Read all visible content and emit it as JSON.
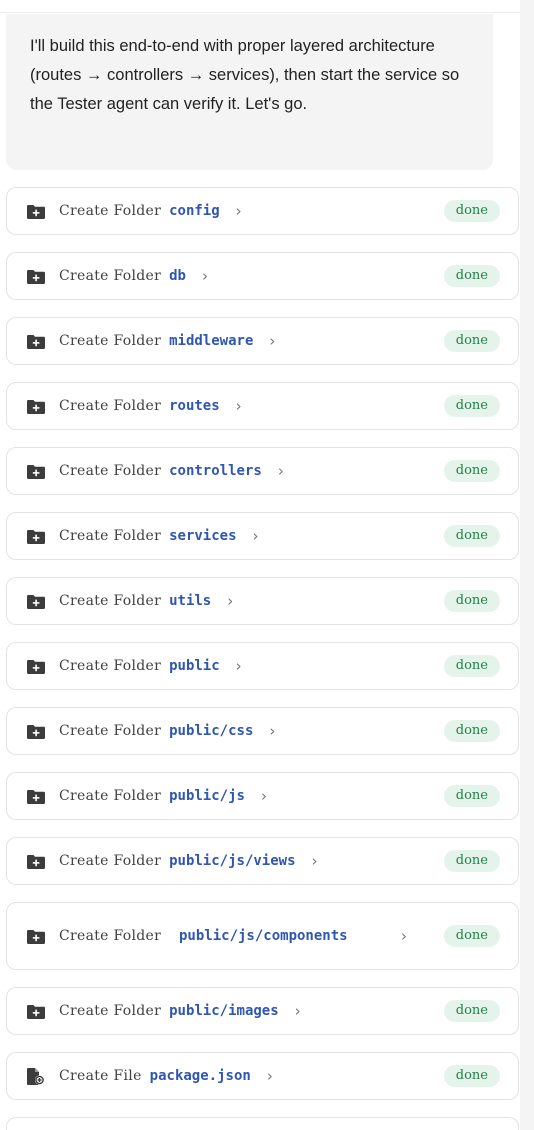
{
  "message": {
    "text": "I'll build this end-to-end with proper layered architecture (routes → controllers → services), then start the service so the Tester agent can verify it. Let's go."
  },
  "colors": {
    "target_text": "#2f56b3",
    "badge_bg": "#e4f4ea",
    "badge_text": "#24804a",
    "icon": "#3c3c3c"
  },
  "steps": [
    {
      "verb": "Create Folder",
      "target": "config",
      "status": "done",
      "icon": "folder-plus-icon"
    },
    {
      "verb": "Create Folder",
      "target": "db",
      "status": "done",
      "icon": "folder-plus-icon"
    },
    {
      "verb": "Create Folder",
      "target": "middleware",
      "status": "done",
      "icon": "folder-plus-icon"
    },
    {
      "verb": "Create Folder",
      "target": "routes",
      "status": "done",
      "icon": "folder-plus-icon"
    },
    {
      "verb": "Create Folder",
      "target": "controllers",
      "status": "done",
      "icon": "folder-plus-icon"
    },
    {
      "verb": "Create Folder",
      "target": "services",
      "status": "done",
      "icon": "folder-plus-icon"
    },
    {
      "verb": "Create Folder",
      "target": "utils",
      "status": "done",
      "icon": "folder-plus-icon"
    },
    {
      "verb": "Create Folder",
      "target": "public",
      "status": "done",
      "icon": "folder-plus-icon"
    },
    {
      "verb": "Create Folder",
      "target": "public/css",
      "status": "done",
      "icon": "folder-plus-icon"
    },
    {
      "verb": "Create Folder",
      "target": "public/js",
      "status": "done",
      "icon": "folder-plus-icon"
    },
    {
      "verb": "Create Folder",
      "target": "public/js/views",
      "status": "done",
      "icon": "folder-plus-icon"
    },
    {
      "verb": "Create Folder",
      "target": "public/js/components",
      "status": "done",
      "icon": "folder-plus-icon"
    },
    {
      "verb": "Create Folder",
      "target": "public/images",
      "status": "done",
      "icon": "folder-plus-icon"
    },
    {
      "verb": "Create File",
      "target": "package.json",
      "status": "done",
      "icon": "file-plus-icon"
    }
  ],
  "chevron": "›"
}
